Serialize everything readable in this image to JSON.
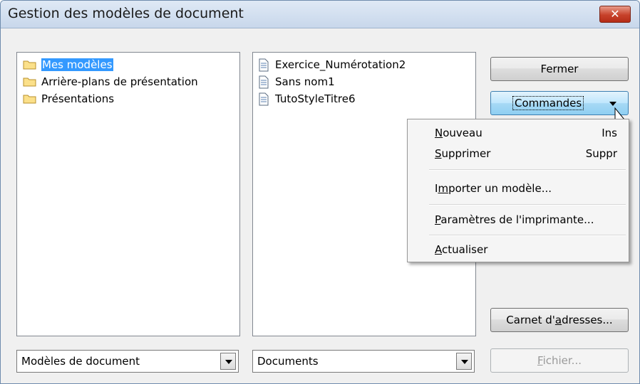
{
  "window": {
    "title": "Gestion des modèles de document",
    "close_label": "✕"
  },
  "categories": [
    {
      "label": "Mes modèles",
      "selected": true
    },
    {
      "label": "Arrière-plans de présentation"
    },
    {
      "label": "Présentations"
    }
  ],
  "templates": [
    {
      "label": "Exercice_Numérotation2"
    },
    {
      "label": "Sans nom1"
    },
    {
      "label": "TutoStyleTitre6"
    }
  ],
  "buttons": {
    "close": "Fermer",
    "commands": "Commandes",
    "address_book": {
      "pre": "Carnet d'",
      "accel": "a",
      "post": "dresses..."
    },
    "file": {
      "accel": "F",
      "post": "ichier..."
    }
  },
  "combos": {
    "left": "Modèles de document",
    "right": "Documents"
  },
  "menu": {
    "items": [
      {
        "accel": "N",
        "post": "ouveau",
        "shortcut": "Ins"
      },
      {
        "accel": "S",
        "post": "upprimer",
        "shortcut": "Suppr"
      },
      {
        "pre": "I",
        "accel": "m",
        "post": "porter un modèle..."
      },
      {
        "accel": "P",
        "post": "aramètres de l'imprimante..."
      },
      {
        "accel": "A",
        "post": "ctualiser"
      }
    ]
  }
}
